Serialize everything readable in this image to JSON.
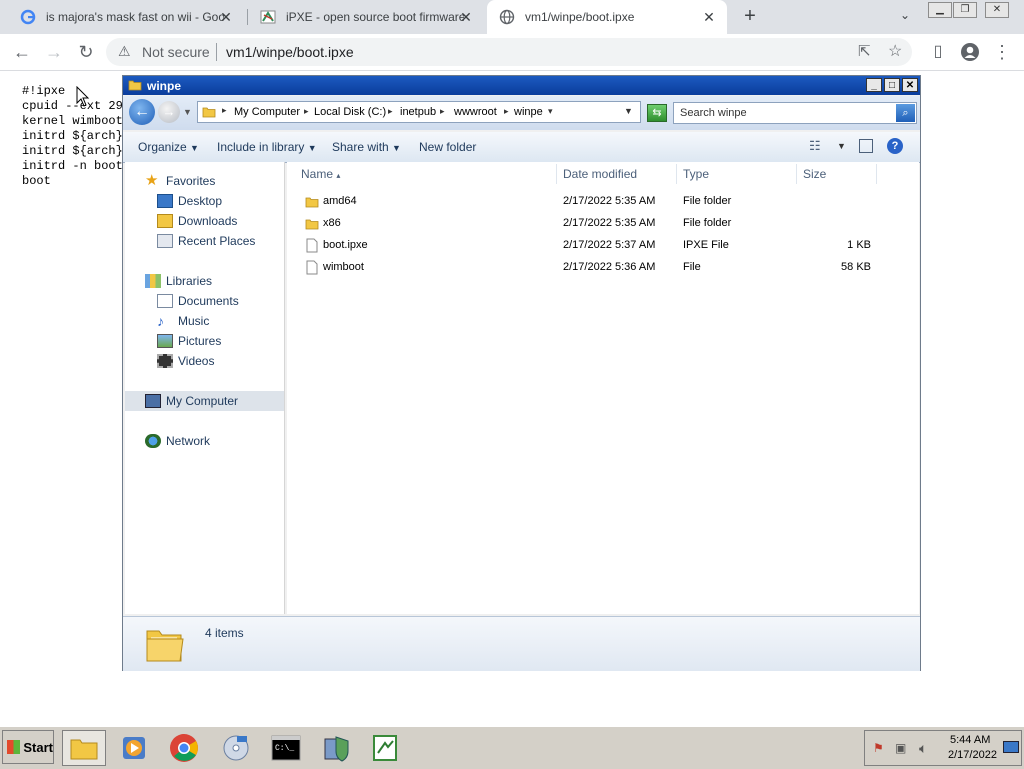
{
  "browser": {
    "tabs": [
      {
        "title": "is majora's mask fast on wii - Googl",
        "favicon": "google-icon"
      },
      {
        "title": "iPXE - open source boot firmware [",
        "favicon": "ipxe-icon"
      },
      {
        "title": "vm1/winpe/boot.ipxe",
        "favicon": "globe-icon",
        "active": true
      }
    ],
    "security_label": "Not secure",
    "url": "vm1/winpe/boot.ipxe"
  },
  "page": {
    "lines": [
      "#!ipxe",
      "",
      "cpuid --ext 29",
      "kernel wimboot",
      "initrd ${arch}",
      "initrd ${arch}",
      "initrd -n boot",
      "boot"
    ]
  },
  "explorer": {
    "title": "winpe",
    "breadcrumb": [
      "My Computer",
      "Local Disk (C:)",
      "inetpub",
      "wwwroot",
      "winpe"
    ],
    "search_placeholder": "Search winpe",
    "commands": {
      "organize": "Organize",
      "include": "Include in library",
      "share": "Share with",
      "new_folder": "New folder"
    },
    "nav": {
      "favorites": "Favorites",
      "favorites_items": [
        "Desktop",
        "Downloads",
        "Recent Places"
      ],
      "libraries": "Libraries",
      "libraries_items": [
        "Documents",
        "Music",
        "Pictures",
        "Videos"
      ],
      "computer": "My Computer",
      "network": "Network"
    },
    "columns": {
      "name": "Name",
      "date": "Date modified",
      "type": "Type",
      "size": "Size"
    },
    "files": [
      {
        "name": "amd64",
        "date": "2/17/2022 5:35 AM",
        "type": "File folder",
        "size": "",
        "icon": "folder-icon"
      },
      {
        "name": "x86",
        "date": "2/17/2022 5:35 AM",
        "type": "File folder",
        "size": "",
        "icon": "folder-icon"
      },
      {
        "name": "boot.ipxe",
        "date": "2/17/2022 5:37 AM",
        "type": "IPXE File",
        "size": "1 KB",
        "icon": "file-icon"
      },
      {
        "name": "wimboot",
        "date": "2/17/2022 5:36 AM",
        "type": "File",
        "size": "58 KB",
        "icon": "file-icon"
      }
    ],
    "status": "4 items"
  },
  "taskbar": {
    "start_label": "Start",
    "time": "5:44 AM",
    "date": "2/17/2022"
  },
  "colors": {
    "chrome_frame": "#dee1e6",
    "xp_title": "#0a3d9c",
    "folder": "#f2c744"
  }
}
